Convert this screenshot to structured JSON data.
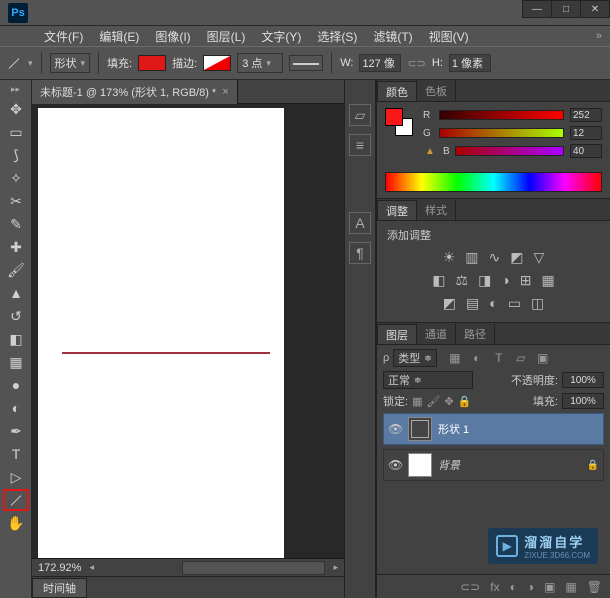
{
  "title_logo": "Ps",
  "win": {
    "min": "—",
    "max": "□",
    "close": "✕"
  },
  "menu": [
    "文件(F)",
    "编辑(E)",
    "图像(I)",
    "图层(L)",
    "文字(Y)",
    "选择(S)",
    "滤镜(T)",
    "视图(V)"
  ],
  "options": {
    "shape_label": "形状",
    "fill_label": "填充:",
    "stroke_label": "描边:",
    "stroke_width": "3 点",
    "w_label": "W:",
    "w_value": "127 像",
    "h_label": "H:",
    "h_value": "1 像素"
  },
  "doc_tab": "未标题-1 @ 173% (形状 1, RGB/8) *",
  "zoom_status": "172.92%",
  "timeline_tab": "时间轴",
  "panel_color": {
    "tab1": "颜色",
    "tab2": "色板",
    "r": "R",
    "g": "G",
    "b": "B",
    "r_val": "252",
    "g_val": "12",
    "b_val": "40"
  },
  "panel_adjust": {
    "tab1": "调整",
    "tab2": "样式",
    "title": "添加调整"
  },
  "panel_layers": {
    "tab1": "图层",
    "tab2": "通道",
    "tab3": "路径",
    "kind": "类型",
    "blend": "正常",
    "opacity_label": "不透明度:",
    "opacity_val": "100%",
    "lock_label": "锁定:",
    "fill_label": "填充:",
    "fill_val": "100%",
    "layer1": "形状 1",
    "layer_bg": "背景"
  },
  "watermark": {
    "title": "溜溜自学",
    "url": "ZIXUE.3D66.COM"
  }
}
